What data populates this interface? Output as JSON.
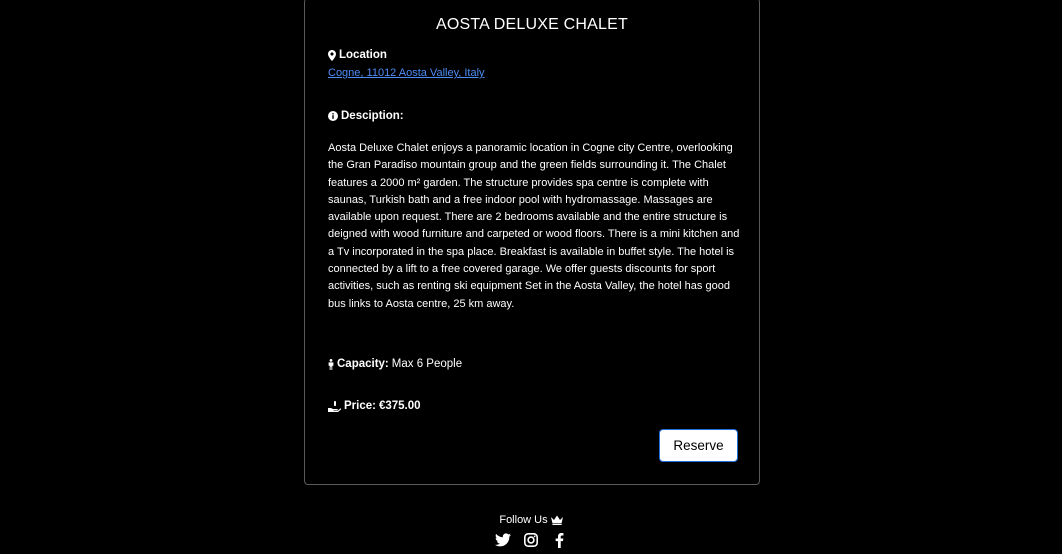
{
  "listing": {
    "title": "AOSTA DELUXE CHALET",
    "location_label": "Location",
    "address": "Cogne, 11012 Aosta Valley, Italy",
    "description_label": "Desciption:",
    "description": "Aosta Deluxe Chalet enjoys a panoramic location in Cogne city Centre, overlooking the Gran Paradiso mountain group and the green fields surrounding it. The Chalet features a 2000 m² garden. The structure provides spa centre is complete with saunas, Turkish bath and a free indoor pool with hydromassage. Massages are available upon request. There are 2 bedrooms available and the entire structure is deigned with wood furniture and carpeted or wood floors. There is a mini kitchen and a Tv incorporated in the spa place. Breakfast is available in buffet style. The hotel is connected by a lift to a free covered garage. We offer guests discounts for sport activities, such as renting ski equipment Set in the Aosta Valley, the hotel has good bus links to Aosta centre, 25 km away.",
    "capacity_label": "Capacity:",
    "capacity_value": "Max 6 People",
    "price_label": "Price:",
    "price_value": "€375.00",
    "reserve_label": "Reserve"
  },
  "footer": {
    "follow_label": "Follow Us",
    "socials": [
      "twitter-icon",
      "instagram-icon",
      "facebook-icon"
    ]
  },
  "colors": {
    "background": "#000000",
    "text": "#ffffff",
    "link": "#4d8df6",
    "button_border": "#1e6fd9",
    "card_border": "#5a5a5a"
  }
}
